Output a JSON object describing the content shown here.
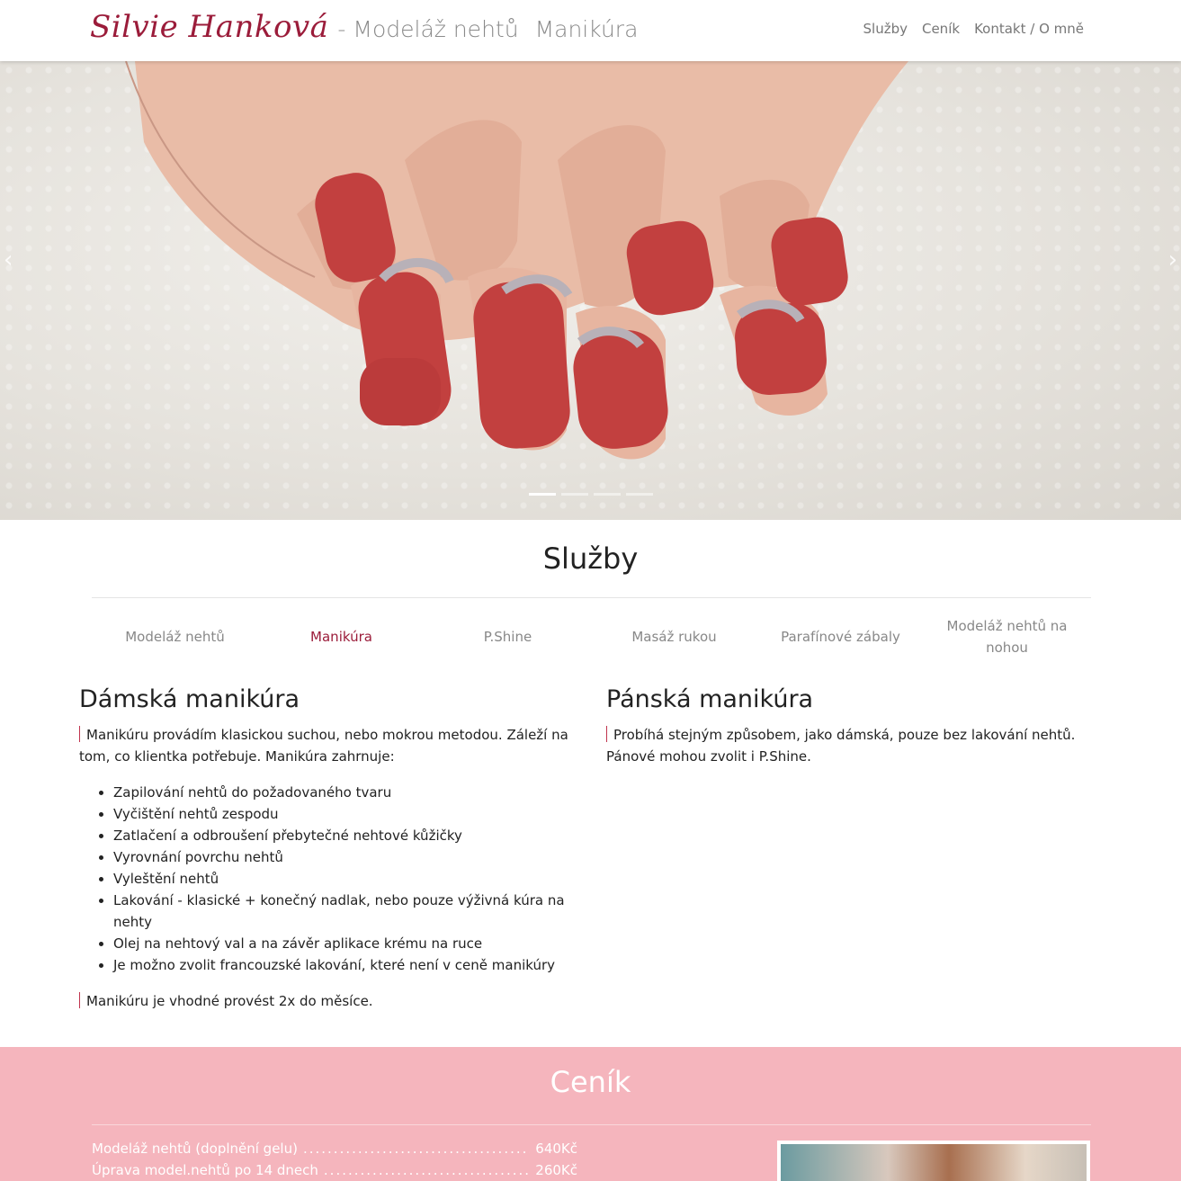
{
  "navbar": {
    "brand_name": "Silvie Hanková",
    "brand_sub": "- Modeláž nehtů",
    "brand_sub2": "Manikúra",
    "links": [
      "Služby",
      "Ceník",
      "Kontakt / O mně"
    ]
  },
  "hero": {
    "slide_count": 4,
    "active_slide": 0
  },
  "services": {
    "title": "Služby",
    "tabs": [
      "Modeláž nehtů",
      "Manikúra",
      "P.Shine",
      "Masáž rukou",
      "Parafínové zábaly",
      "Modeláž nehtů na nohou"
    ],
    "active_tab": "Manikúra",
    "left": {
      "heading": "Dámská manikúra",
      "lead": "Manikúru provádím klasickou suchou, nebo mokrou metodou. Záleží na tom, co klientka potřebuje. Manikúra zahrnuje:",
      "items": [
        "Zapilování nehtů do požadovaného tvaru",
        "Vyčištění nehtů zespodu",
        "Zatlačení a odbroušení přebytečné nehtové kůžičky",
        "Vyrovnání povrchu nehtů",
        "Vyleštění nehtů",
        "Lakování - klasické + konečný nadlak, nebo pouze výživná kúra na nehty",
        "Olej na nehtový val a na závěr aplikace krému na ruce",
        "Je možno zvolit francouzské lakování, které není v ceně manikúry"
      ],
      "note": "Manikúru je vhodné provést 2x do měsíce."
    },
    "right": {
      "heading": "Pánská manikúra",
      "lead": "Probíhá stejným způsobem, jako dámská, pouze bez lakování nehtů. Pánové mohou zvolit i P.Shine."
    }
  },
  "pricing": {
    "title": "Ceník",
    "rows": [
      {
        "name": "Modeláž nehtů (doplnění gelu)",
        "price": "640Kč"
      },
      {
        "name": "Úprava model.nehtů po 14 dnech",
        "price": "260Kč"
      }
    ]
  },
  "colors": {
    "brand": "#9b1c3a",
    "pricing_bg": "#f5b5bd",
    "nail_red": "#c2403f"
  }
}
